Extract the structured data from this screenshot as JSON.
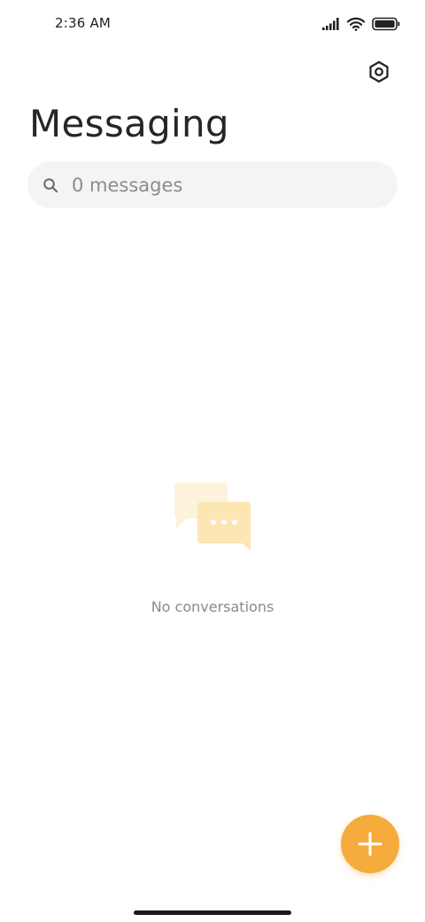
{
  "status_bar": {
    "time": "2:36 AM",
    "icons": [
      "signal-icon",
      "wifi-icon",
      "battery-icon"
    ]
  },
  "header": {
    "title": "Messaging",
    "settings_icon": "gear-icon"
  },
  "search": {
    "placeholder": "0 messages",
    "value": "",
    "icon": "search-icon"
  },
  "empty_state": {
    "icon": "chat-bubbles-icon",
    "text": "No conversations"
  },
  "fab": {
    "icon": "plus-icon"
  },
  "colors": {
    "accent": "#f5ac3c",
    "illustration_light": "#fdf3dc",
    "illustration_main": "#fce6b3",
    "search_bg": "#f4f4f4",
    "title": "#262626"
  }
}
